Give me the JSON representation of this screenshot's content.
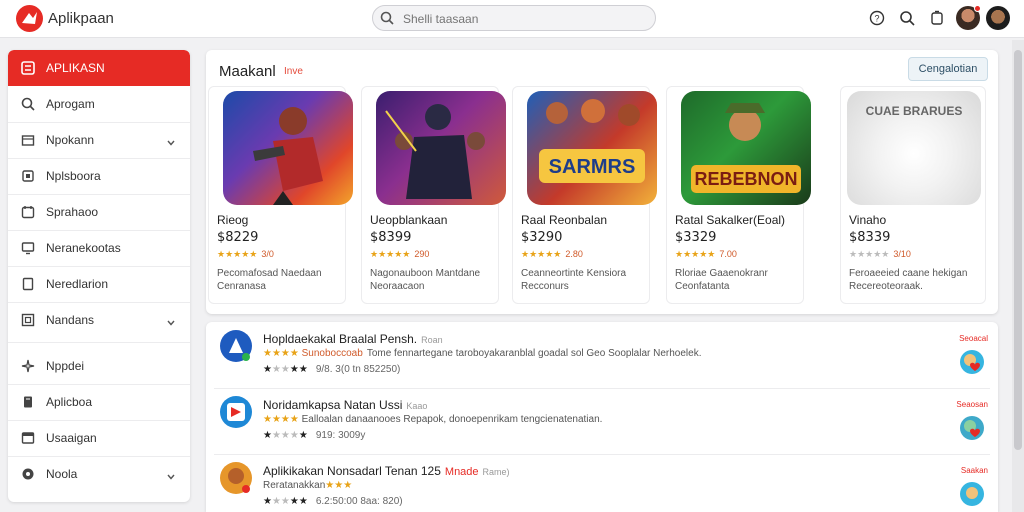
{
  "header": {
    "app_name": "Aplikpaan",
    "search_placeholder": "Shelli taasaan",
    "icons": [
      "help-icon",
      "search-icon",
      "notification-icon"
    ]
  },
  "sidebar": {
    "items": [
      {
        "label": "APLIKASN",
        "icon": "apps-icon",
        "active": true
      },
      {
        "label": "Aprogam",
        "icon": "search-icon"
      },
      {
        "label": "Npokann",
        "icon": "box-icon",
        "chevron": true
      },
      {
        "label": "Nplsboora",
        "icon": "square-icon"
      },
      {
        "label": "Sprahaoo",
        "icon": "calendar-icon"
      },
      {
        "label": "Neranekootas",
        "icon": "monitor-icon"
      },
      {
        "label": "Neredlarion",
        "icon": "tablet-icon"
      },
      {
        "label": "Nandans",
        "icon": "grid-icon",
        "chevron": true
      },
      {
        "label": "Nppdei",
        "icon": "sparkle-icon"
      },
      {
        "label": "Aplicboa",
        "icon": "book-icon"
      },
      {
        "label": "Usaaigan",
        "icon": "window-icon"
      },
      {
        "label": "Noola",
        "icon": "pin-icon",
        "chevron": true
      }
    ]
  },
  "featured": {
    "title": "Maakanl",
    "subtitle": "Inve",
    "button": "Cengalotian",
    "cards": [
      {
        "name": "Rieog",
        "price": "$8229",
        "stars": "★★★★★",
        "count": "3/0",
        "desc": "Pecomafosad Naedaan Cenranasa"
      },
      {
        "name": "Ueopblankaan",
        "price": "$8399",
        "stars": "★★★★★",
        "count": "290",
        "desc": "Nagonauboon Mantdane Neoraacaon"
      },
      {
        "name": "Raal Reonbalan",
        "price": "$3290",
        "stars": "★★★★★",
        "count": "2.80",
        "desc": "Ceanneortinte Kensiora Recconurs"
      },
      {
        "name": "Ratal Sakalker(Eoal)",
        "price": "$3329",
        "stars": "★★★★★",
        "count": "7.00",
        "desc": "Rloriae Gaaenokranr Ceonfatanta"
      },
      {
        "name": "Vinaho",
        "price": "$8339",
        "stars": "★★★★★",
        "count": "3/10",
        "desc": "Feroaeeied caane hekigan Recereoteoraak."
      }
    ]
  },
  "list": {
    "items": [
      {
        "title": "Hopldaekakal Braalal Pensh.",
        "tag": "Roan",
        "stars": "★★★★",
        "orange": "Sunoboccoab",
        "desc": "Tome fennartegane taroboyakaranblal goadal sol Geo Sooplalar Nerhoelek.",
        "rating": "★",
        "grey_stars": "★★",
        "rating2": "★★",
        "count": "9/8. 3(0 tn 852250)",
        "badge": "Seoacal"
      },
      {
        "title": "Noridamkapsa Natan Ussi",
        "tag": "Kaao",
        "stars": "★★★★",
        "orange": "",
        "desc": "Ealloalan danaanooes Repapok, donoepenrikam tengcienatenatian.",
        "rating": "★",
        "grey_stars": "★★★",
        "rating2": "★",
        "count": "919: 3009y",
        "badge": "Seaosan"
      },
      {
        "title": "Aplikikakan Nonsadarl Tenan 125",
        "tag": "Mnade",
        "tag2": "Rame)",
        "stars": "★★★",
        "orange": "",
        "desc": "Reratanakkan",
        "rating": "★",
        "grey_stars": "★★",
        "rating2": "★★",
        "count": "6.2:50:00 8aa: 820)",
        "badge": "Saakan"
      }
    ]
  }
}
